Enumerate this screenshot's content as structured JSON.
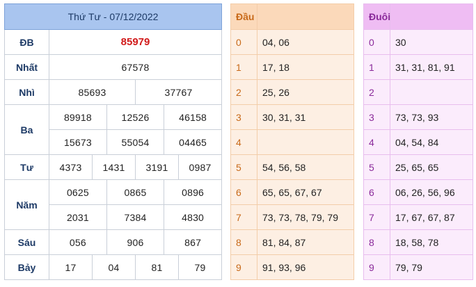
{
  "results": {
    "header": "Thứ Tư - 07/12/2022",
    "prizes": [
      {
        "label": "ĐB",
        "numbers": [
          "85979"
        ]
      },
      {
        "label": "Nhất",
        "numbers": [
          "67578"
        ]
      },
      {
        "label": "Nhì",
        "numbers": [
          "85693",
          "37767"
        ]
      },
      {
        "label": "Ba",
        "numbers": [
          "89918",
          "12526",
          "46158",
          "15673",
          "55054",
          "04465"
        ]
      },
      {
        "label": "Tư",
        "numbers": [
          "4373",
          "1431",
          "3191",
          "0987"
        ]
      },
      {
        "label": "Năm",
        "numbers": [
          "0625",
          "0865",
          "0896",
          "2031",
          "7384",
          "4830"
        ]
      },
      {
        "label": "Sáu",
        "numbers": [
          "056",
          "906",
          "867"
        ]
      },
      {
        "label": "Bảy",
        "numbers": [
          "17",
          "04",
          "81",
          "79"
        ]
      }
    ]
  },
  "dau": {
    "header": "Đầu",
    "rows": [
      {
        "key": "0",
        "values": "04, 06"
      },
      {
        "key": "1",
        "values": "17, 18"
      },
      {
        "key": "2",
        "values": "25, 26"
      },
      {
        "key": "3",
        "values": "30, 31, 31"
      },
      {
        "key": "4",
        "values": ""
      },
      {
        "key": "5",
        "values": "54, 56, 58"
      },
      {
        "key": "6",
        "values": "65, 65, 67, 67"
      },
      {
        "key": "7",
        "values": "73, 73, 78, 79, 79"
      },
      {
        "key": "8",
        "values": "81, 84, 87"
      },
      {
        "key": "9",
        "values": "91, 93, 96"
      }
    ]
  },
  "duoi": {
    "header": "Đuôi",
    "rows": [
      {
        "key": "0",
        "values": "30"
      },
      {
        "key": "1",
        "values": "31, 31, 81, 91"
      },
      {
        "key": "2",
        "values": ""
      },
      {
        "key": "3",
        "values": "73, 73, 93"
      },
      {
        "key": "4",
        "values": "04, 54, 84"
      },
      {
        "key": "5",
        "values": "25, 65, 65"
      },
      {
        "key": "6",
        "values": "06, 26, 56, 96"
      },
      {
        "key": "7",
        "values": "17, 67, 67, 87"
      },
      {
        "key": "8",
        "values": "18, 58, 78"
      },
      {
        "key": "9",
        "values": "79, 79"
      }
    ]
  }
}
